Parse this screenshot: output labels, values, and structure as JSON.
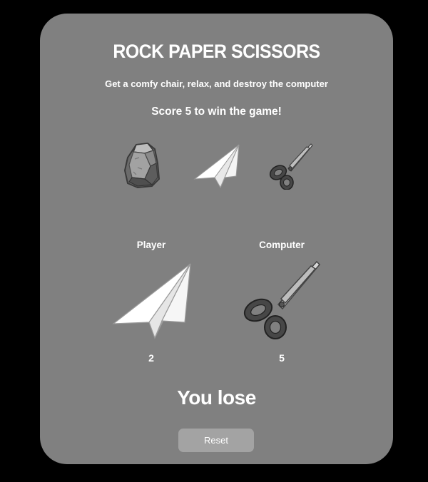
{
  "header": {
    "title": "ROCK PAPER SCISSORS",
    "subtitle": "Get a comfy chair, relax, and destroy the computer",
    "goal": "Score 5 to win the game!"
  },
  "choices": [
    {
      "name": "rock",
      "icon": "rock-icon"
    },
    {
      "name": "paper",
      "icon": "paper-plane-icon"
    },
    {
      "name": "scissors",
      "icon": "scissors-icon"
    }
  ],
  "player": {
    "label": "Player",
    "choice": "paper",
    "choice_icon": "paper-plane-icon",
    "score": "2"
  },
  "computer": {
    "label": "Computer",
    "choice": "scissors",
    "choice_icon": "scissors-icon",
    "score": "5"
  },
  "result": "You lose",
  "reset_label": "Reset",
  "colors": {
    "background": "#000000",
    "card": "#808080",
    "text": "#ffffff",
    "button": "#a3a3a3"
  }
}
